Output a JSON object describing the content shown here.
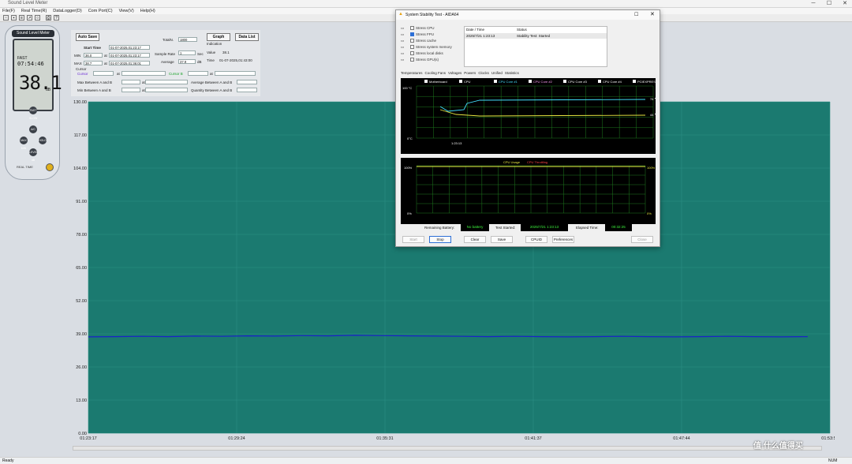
{
  "app": {
    "title": "Sound Level Meter",
    "window_controls": [
      "─",
      "☐",
      "✕"
    ]
  },
  "menu": [
    "File(F)",
    "Real Time(R)",
    "DataLogger(D)",
    "Com Port(C)",
    "View(V)",
    "Help(H)"
  ],
  "meter": {
    "header": "Sound Level Meter",
    "top": "FAST",
    "clock": "07:54:46",
    "value": "38.1",
    "unit": "dB",
    "buttons": [
      "FAST SLOW",
      "A/C",
      "MAX MIN",
      "HOLD",
      "LEVEL dB"
    ],
    "brand": "REAL TIME"
  },
  "controls": {
    "auto_save": "Auto Save",
    "graph": "Graph",
    "data_list": "Data List",
    "start_time_label": "Start Time",
    "start_time": "01-07-2025,01:23:17",
    "totalnum_label": "TotalN.",
    "totalnum": "1800",
    "min_label": "MIN",
    "min": "36.0",
    "min_time": "01-07-2025,01:23:17",
    "sample_rate_label": "Sample Rate",
    "sample_rate": "1",
    "sample_unit": "Sec",
    "max_label": "MAX",
    "max": "38.7",
    "max_time": "01-07-2025,01:36:01",
    "average_label": "Average",
    "average": "37.9",
    "average_unit": "dB",
    "indication": "Indication",
    "value_label": "Value",
    "value": "38.1",
    "time_label": "Time",
    "time": "01-07-2025,01:43:00",
    "cursor_label": "Cursor",
    "cursor_a": "Cursor",
    "cursor_b": "Cursor B",
    "max_ab": "Max Between A and B",
    "min_ab": "Min Between A and B",
    "avg_ab": "Average Between A and B",
    "qty_ab": "Quantity Between A and B",
    "at": "at"
  },
  "chart_data": {
    "type": "line",
    "ylim": [
      0,
      130
    ],
    "yticks": [
      "130.00",
      "117.00",
      "104.00",
      "91.00",
      "78.00",
      "65.00",
      "52.00",
      "39.00",
      "26.00",
      "13.00",
      "0.00"
    ],
    "xticks": [
      "01:23:17",
      "01:29:24",
      "01:35:31",
      "01:41:37",
      "01:47:44",
      "01:53:51"
    ],
    "series": [
      {
        "values": [
          37.8,
          37.9,
          38.0,
          37.9,
          38.1,
          38.0,
          38.2,
          38.1,
          38.3,
          38.2,
          38.4,
          38.3,
          38.2,
          38.1,
          38.0,
          37.9,
          38.0,
          37.9,
          37.8,
          37.9,
          38.0,
          37.9,
          37.8,
          37.9,
          38.0,
          37.9,
          37.8,
          37.9
        ]
      }
    ],
    "colors": {
      "plot": "#1b7a70",
      "line": "#1a22c8",
      "grid": "#2d8f84"
    }
  },
  "stability": {
    "title": "System Stability Test - AIDA64",
    "checks": [
      {
        "label": "Stress CPU",
        "on": false
      },
      {
        "label": "Stress FPU",
        "on": true
      },
      {
        "label": "Stress cache",
        "on": false
      },
      {
        "label": "Stress system memory",
        "on": false
      },
      {
        "label": "Stress local disks",
        "on": false
      },
      {
        "label": "Stress GPU(s)",
        "on": false
      }
    ],
    "log_headers": [
      "Date / Time",
      "Status"
    ],
    "log_row": [
      "2025/7/21 1:23:13",
      "Stability Test: Started"
    ],
    "tabs": [
      "Temperatures",
      "Cooling Fans",
      "Voltages",
      "Powers",
      "Clocks",
      "Unified",
      "Statistics"
    ],
    "legend": [
      "Motherboard",
      "CPU",
      "CPU Core #1",
      "CPU Core #2",
      "CPU Core #3",
      "CPU Core #4",
      "PCIEXPRESS EVEN"
    ],
    "temp_top": "100 °C",
    "temp_bottom": "0°C",
    "temp_time": "1:23:13",
    "temp_r1": "74 ℃",
    "temp_r2": "44 ℃",
    "cpu_title": "CPU Usage",
    "cpu_throttle": "CPU Throttling",
    "cpu_top": "100%",
    "cpu_bottom": "0%",
    "cpu_r1": "100%",
    "cpu_r2": "0%",
    "remaining_label": "Remaining Battery:",
    "remaining": "No battery",
    "test_started_label": "Test Started:",
    "test_started": "2025/7/21 1:23:13",
    "elapsed_label": "Elapsed Time:",
    "elapsed": "00:32:25",
    "buttons": [
      "Start",
      "Stop",
      "Clear",
      "Save",
      "CPUID",
      "Preferences",
      "Close"
    ]
  },
  "status": {
    "left": "Ready",
    "right": "NUM"
  },
  "watermark": "值 什么值得买"
}
